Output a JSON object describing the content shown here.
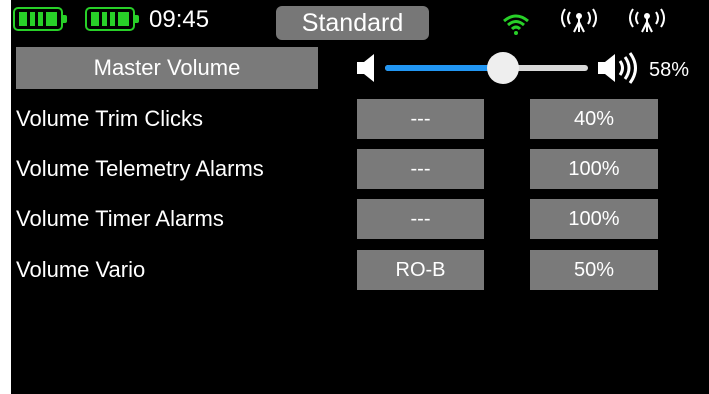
{
  "status": {
    "time": "09:45",
    "model_name": "Standard",
    "battery_tx_level": 1.0,
    "battery_rx_level": 1.0,
    "colors": {
      "battery": "#28d028",
      "wifi": "#28d028",
      "accent": "#2196f3"
    }
  },
  "master_volume": {
    "label": "Master Volume",
    "level_percent": 58,
    "value": "58%"
  },
  "rows": [
    {
      "label": "Volume Trim Clicks",
      "source": "---",
      "value": "40%"
    },
    {
      "label": "Volume Telemetry Alarms",
      "source": "---",
      "value": "100%"
    },
    {
      "label": "Volume Timer Alarms",
      "source": "---",
      "value": "100%"
    },
    {
      "label": "Volume Vario",
      "source": "RO-B",
      "value": "50%"
    }
  ],
  "icons": {
    "wifi": "wifi-icon",
    "antenna": "antenna-icon",
    "speaker_low": "speaker-low-icon",
    "speaker_high": "speaker-high-icon",
    "battery": "battery-icon"
  }
}
